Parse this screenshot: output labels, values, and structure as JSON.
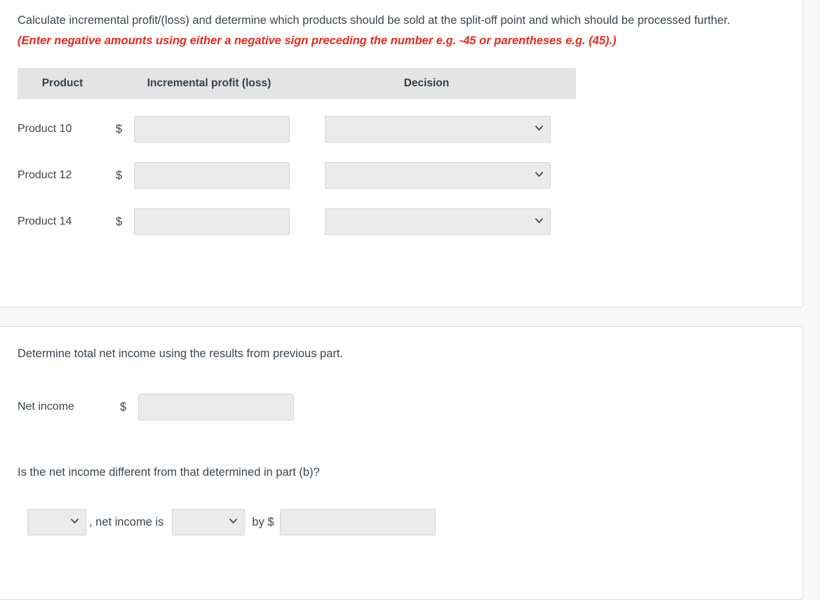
{
  "section_a": {
    "prompt_main": "Calculate incremental profit/(loss) and determine which products should be sold at the split-off point and which should be processed further. ",
    "prompt_note": "(Enter negative amounts using either a negative sign preceding the number e.g. -45 or parentheses e.g. (45).)",
    "table": {
      "headers": {
        "product": "Product",
        "profit": "Incremental profit (loss)",
        "decision": "Decision"
      },
      "rows": [
        {
          "product": "Product 10",
          "currency": "$",
          "profit_value": "",
          "profit_placeholder": "",
          "decision_value": ""
        },
        {
          "product": "Product 12",
          "currency": "$",
          "profit_value": "",
          "profit_placeholder": "",
          "decision_value": ""
        },
        {
          "product": "Product 14",
          "currency": "$",
          "profit_value": "",
          "profit_placeholder": "",
          "decision_value": ""
        }
      ]
    }
  },
  "section_b": {
    "prompt": "Determine total net income using the results from previous part.",
    "net_income_label": "Net income",
    "net_income_currency": "$",
    "net_income_value": "",
    "question": "Is the net income different from that determined in part (b)?",
    "answer_select_value": "",
    "mid_text": ", net income is",
    "direction_select_value": "",
    "by_text": "by $",
    "amount_value": ""
  },
  "icons": {
    "chevron_down": "chevron-down-icon"
  },
  "colors": {
    "note_red": "#e8291c",
    "header_bg": "#e4e4e4",
    "field_bg": "#ebebeb",
    "field_border": "#d6d6d6",
    "text": "#3b464f",
    "card_border": "#e0e0e0",
    "page_bg": "#f7f7f7"
  }
}
